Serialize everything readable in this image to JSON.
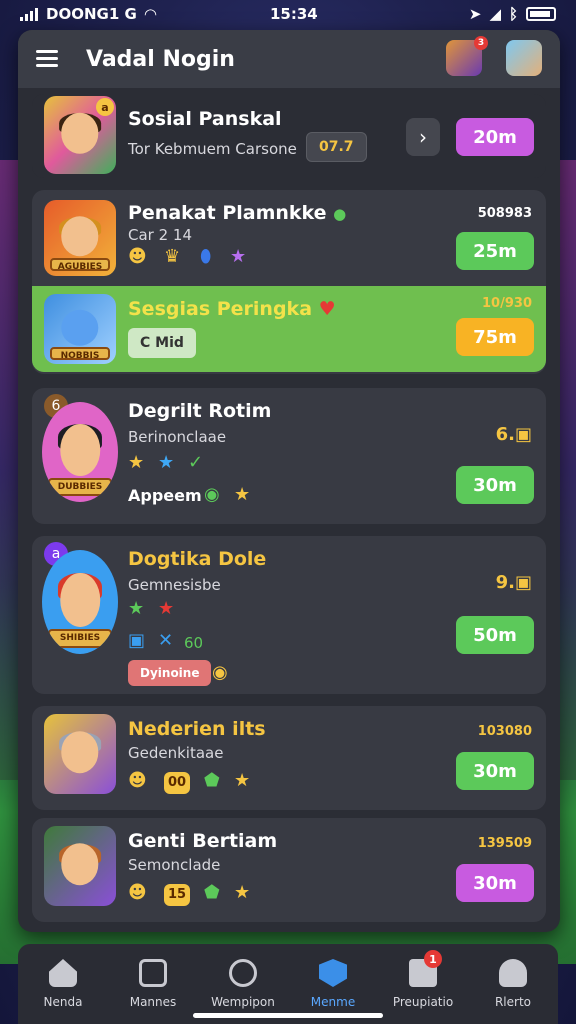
{
  "status": {
    "time": "15:34",
    "carrier": "DOONG1 G"
  },
  "header": {
    "title": "Vadal Nogin",
    "avatar_badge": "3"
  },
  "featured": {
    "name": "Sosial Panskal",
    "subtitle": "Tor Kebmuem Carsone",
    "chip": "07.7",
    "avatar_badge": "a",
    "button": "20m"
  },
  "rows": [
    {
      "name": "Penakat Plamnkke",
      "sub": "Car 2 14",
      "tag": "AGUBIES",
      "value": "508983",
      "button": "25m"
    },
    {
      "name": "Sesgias Peringka",
      "tag": "NOBBIS",
      "chip": "C Mid",
      "value": "10/930",
      "button": "75m"
    },
    {
      "name": "Degrilt Rotim",
      "sub": "Berinonclaae",
      "tag": "DUBBIES",
      "extra": "Appeem",
      "value": "6.",
      "badge": "6",
      "button": "30m"
    },
    {
      "name": "Dogtika Dole",
      "sub": "Gemnesisbe",
      "tag": "SHIBIES",
      "stat": "60",
      "chip": "Dyinoine",
      "value": "9.",
      "badge": "a",
      "button": "50m"
    },
    {
      "name": "Nederien ilts",
      "sub": "Gedenkitaae",
      "stat": "00",
      "value": "103080",
      "button": "30m"
    },
    {
      "name": "Genti Bertiam",
      "sub": "Semonclade",
      "stat": "15",
      "value": "139509",
      "button": "30m"
    }
  ],
  "nav": [
    {
      "label": "Nenda"
    },
    {
      "label": "Mannes"
    },
    {
      "label": "Wempipon"
    },
    {
      "label": "Menme"
    },
    {
      "label": "Preupiatio",
      "badge": "1"
    },
    {
      "label": "Rlerto"
    }
  ],
  "colors": {
    "green": "#5cc95a",
    "purple": "#c85be0",
    "orange": "#f8b324",
    "gold": "#f5c542",
    "panel": "#2b2d35"
  }
}
